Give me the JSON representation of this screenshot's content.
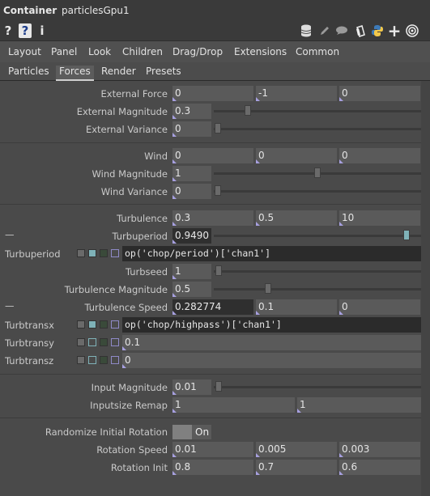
{
  "title": {
    "op_type": "Container",
    "op_name": "particlesGpu1"
  },
  "icons": {
    "left": [
      "help-icon",
      "python-help-icon",
      "info-icon"
    ],
    "right": [
      "database-icon",
      "pencil-icon",
      "comment-icon",
      "clone-icon",
      "python-icon",
      "plus-icon",
      "target-icon"
    ]
  },
  "iconbar": {
    "help": "?",
    "py_help": "?",
    "info": "i",
    "plus": "+"
  },
  "tabs_top": [
    "Layout",
    "Panel",
    "Look",
    "Children",
    "Drag/Drop",
    "Extensions",
    "Common"
  ],
  "tabs_sub": [
    "Particles",
    "Forces",
    "Render",
    "Presets"
  ],
  "active_sub_tab": "Forces",
  "params": {
    "external_force": {
      "label": "External Force",
      "values": [
        "0",
        "-1",
        "0"
      ]
    },
    "external_magnitude": {
      "label": "External Magnitude",
      "value": "0.3",
      "slider": 0.3
    },
    "external_variance": {
      "label": "External Variance",
      "value": "0",
      "slider": 0.0
    },
    "wind": {
      "label": "Wind",
      "values": [
        "0",
        "0",
        "0"
      ]
    },
    "wind_magnitude": {
      "label": "Wind Magnitude",
      "value": "1",
      "slider": 0.5
    },
    "wind_variance": {
      "label": "Wind Variance",
      "value": "0",
      "slider": 0.0
    },
    "turbulence": {
      "label": "Turbulence",
      "values": [
        "0.3",
        "0.5",
        "10"
      ]
    },
    "turbuperiod": {
      "label": "Turbuperiod",
      "value": "0.9490",
      "slider": 0.95
    },
    "turbuperiod_expr": {
      "label": "Turbuperiod",
      "expr": "op('chop/period')['chan1']"
    },
    "turbseed": {
      "label": "Turbseed",
      "value": "1",
      "slider": 0.0
    },
    "turbulence_magnitude": {
      "label": "Turbulence Magnitude",
      "value": "0.5",
      "slider": 0.25
    },
    "turbulence_speed": {
      "label": "Turbulence Speed",
      "values": [
        "0.282774",
        "0.1",
        "0"
      ]
    },
    "turbtransx": {
      "label": "Turbtransx",
      "expr": "op('chop/highpass')['chan1']"
    },
    "turbtransy": {
      "label": "Turbtransy",
      "value": "0.1"
    },
    "turbtransz": {
      "label": "Turbtransz",
      "value": "0"
    },
    "input_magnitude": {
      "label": "Input Magnitude",
      "value": "0.01",
      "slider": 0.01
    },
    "inputsize_remap": {
      "label": "Inputsize Remap",
      "values": [
        "1",
        "1"
      ]
    },
    "randomize_initial_rotation": {
      "label": "Randomize Initial Rotation",
      "state": "On"
    },
    "rotation_speed": {
      "label": "Rotation Speed",
      "values": [
        "0.01",
        "0.005",
        "0.003"
      ]
    },
    "rotation_init": {
      "label": "Rotation Init",
      "values": [
        "0.8",
        "0.7",
        "0.6"
      ]
    }
  },
  "dash": "—",
  "colors": {
    "mode_blue": "#7fb2b8",
    "mode_green": "#3a4a3a",
    "mode_purple": "#8f8ac8",
    "field_marker": "#a7a0e0"
  }
}
